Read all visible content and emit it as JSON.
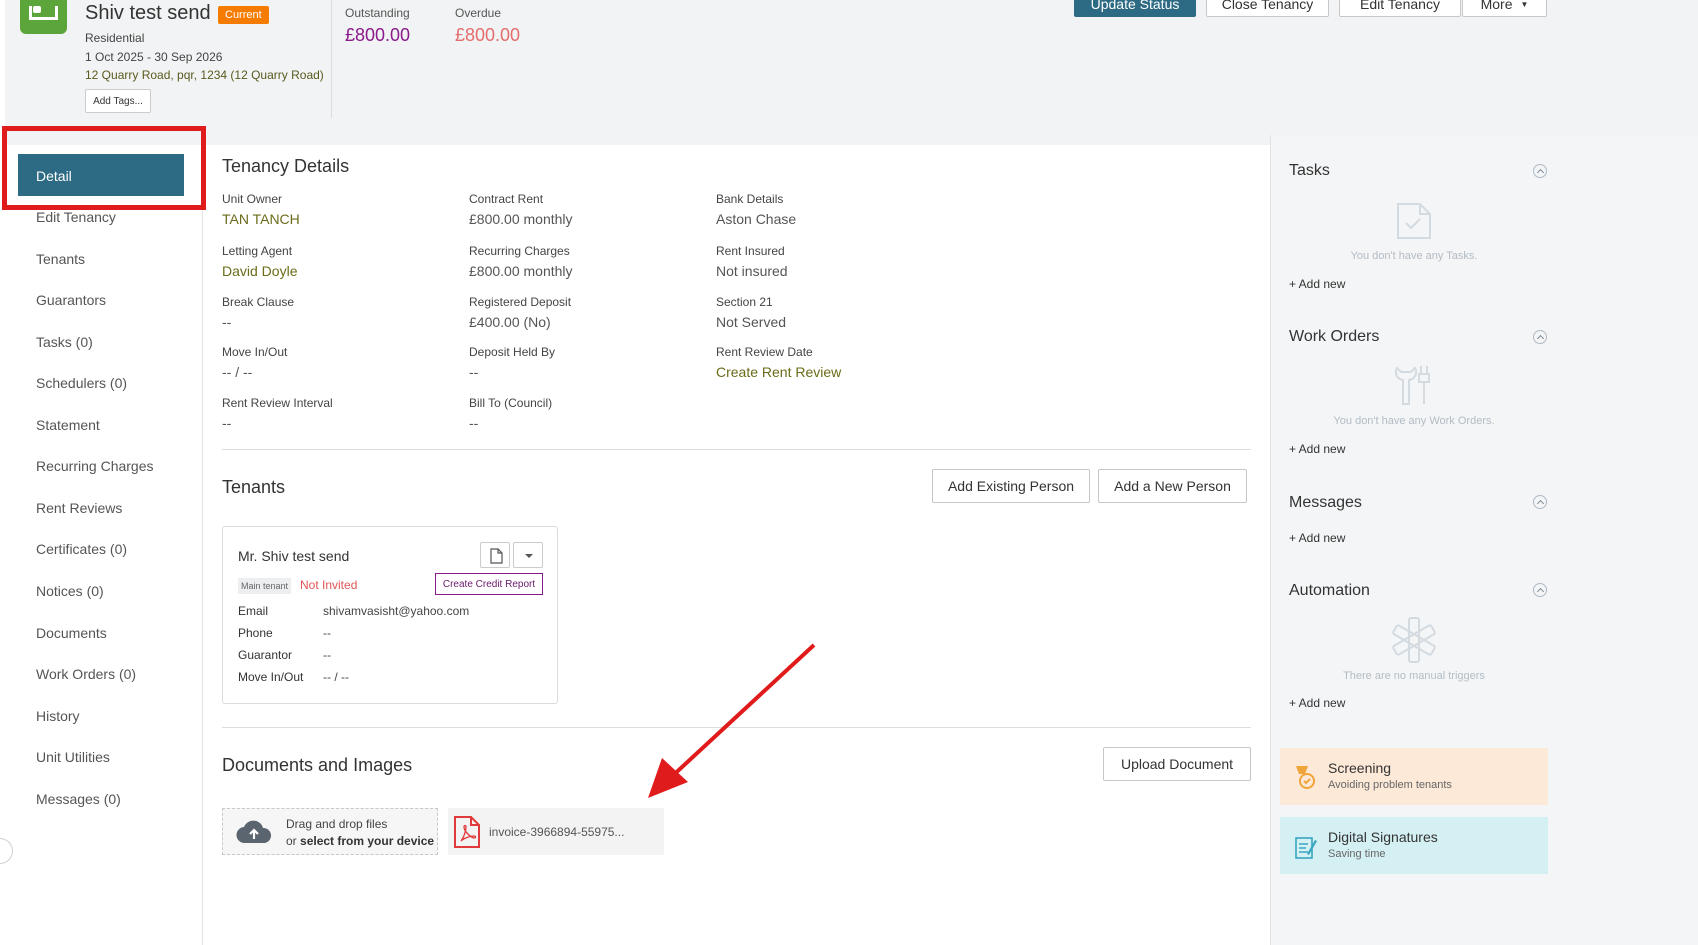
{
  "header": {
    "title": "Shiv test send",
    "status": "Current",
    "type": "Residential",
    "dates": "1 Oct 2025 - 30 Sep 2026",
    "address": "12 Quarry Road, pqr, 1234 (12 Quarry Road)",
    "add_tags": "Add Tags...",
    "outstanding_label": "Outstanding",
    "outstanding_value": "£800.00",
    "overdue_label": "Overdue",
    "overdue_value": "£800.00",
    "buttons": {
      "update_status": "Update Status",
      "close_tenancy": "Close Tenancy",
      "edit_tenancy": "Edit Tenancy",
      "more": "More"
    },
    "colors": {
      "unit_icon": "#5ba53a",
      "status_pill": "#f57c00",
      "outstanding": "#8b1a8b",
      "overdue": "#e46d6d",
      "primary": "#2d6a83"
    }
  },
  "sidebar": {
    "active": "Detail",
    "items": [
      "Edit Tenancy",
      "Tenants",
      "Guarantors",
      "Tasks (0)",
      "Schedulers (0)",
      "Statement",
      "Recurring Charges",
      "Rent Reviews",
      "Certificates (0)",
      "Notices (0)",
      "Documents",
      "Work Orders (0)",
      "History",
      "Unit Utilities",
      "Messages (0)"
    ]
  },
  "details": {
    "title": "Tenancy Details",
    "fields": [
      {
        "label": "Unit Owner",
        "value": "TAN TANCH"
      },
      {
        "label": "Contract Rent",
        "value": "£800.00 monthly"
      },
      {
        "label": "Bank Details",
        "value": "Aston Chase"
      },
      {
        "label": "Letting Agent",
        "value": "David Doyle"
      },
      {
        "label": "Recurring Charges",
        "value": "£800.00 monthly"
      },
      {
        "label": "Rent Insured",
        "value": "Not insured"
      },
      {
        "label": "Break Clause",
        "value": "--"
      },
      {
        "label": "Registered Deposit",
        "value": "£400.00 (No)"
      },
      {
        "label": "Section 21",
        "value": "Not Served"
      },
      {
        "label": "Move In/Out",
        "value": "-- / --"
      },
      {
        "label": "Deposit Held By",
        "value": "--"
      },
      {
        "label": "Rent Review Date",
        "value": "Create Rent Review"
      },
      {
        "label": "Rent Review Interval",
        "value": "--"
      },
      {
        "label": "Bill To (Council)",
        "value": "--"
      }
    ]
  },
  "tenants": {
    "title": "Tenants",
    "add_existing": "Add Existing Person",
    "add_new": "Add a New Person",
    "card": {
      "name": "Mr. Shiv test send",
      "badge": "Main tenant",
      "invite_status": "Not Invited",
      "credit_button": "Create Credit Report",
      "rows": [
        {
          "k": "Email",
          "v": "shivamvasisht@yahoo.com"
        },
        {
          "k": "Phone",
          "v": "--"
        },
        {
          "k": "Guarantor",
          "v": "--"
        },
        {
          "k": "Move In/Out",
          "v": "-- / --"
        }
      ]
    }
  },
  "documents": {
    "title": "Documents and Images",
    "upload": "Upload Document",
    "drop_line1": "Drag and drop files",
    "drop_line2_prefix": "or ",
    "drop_line2_link": "select from your device",
    "file_name": "invoice-3966894-55975..."
  },
  "right": {
    "tasks_title": "Tasks",
    "tasks_empty": "You don't have any Tasks.",
    "work_orders_title": "Work Orders",
    "work_orders_empty": "You don't have any Work Orders.",
    "messages_title": "Messages",
    "automation_title": "Automation",
    "automation_empty": "There are no manual triggers",
    "add_new": "+ Add new",
    "screening_title": "Screening",
    "screening_sub": "Avoiding problem tenants",
    "signatures_title": "Digital Signatures",
    "signatures_sub": "Saving time"
  }
}
